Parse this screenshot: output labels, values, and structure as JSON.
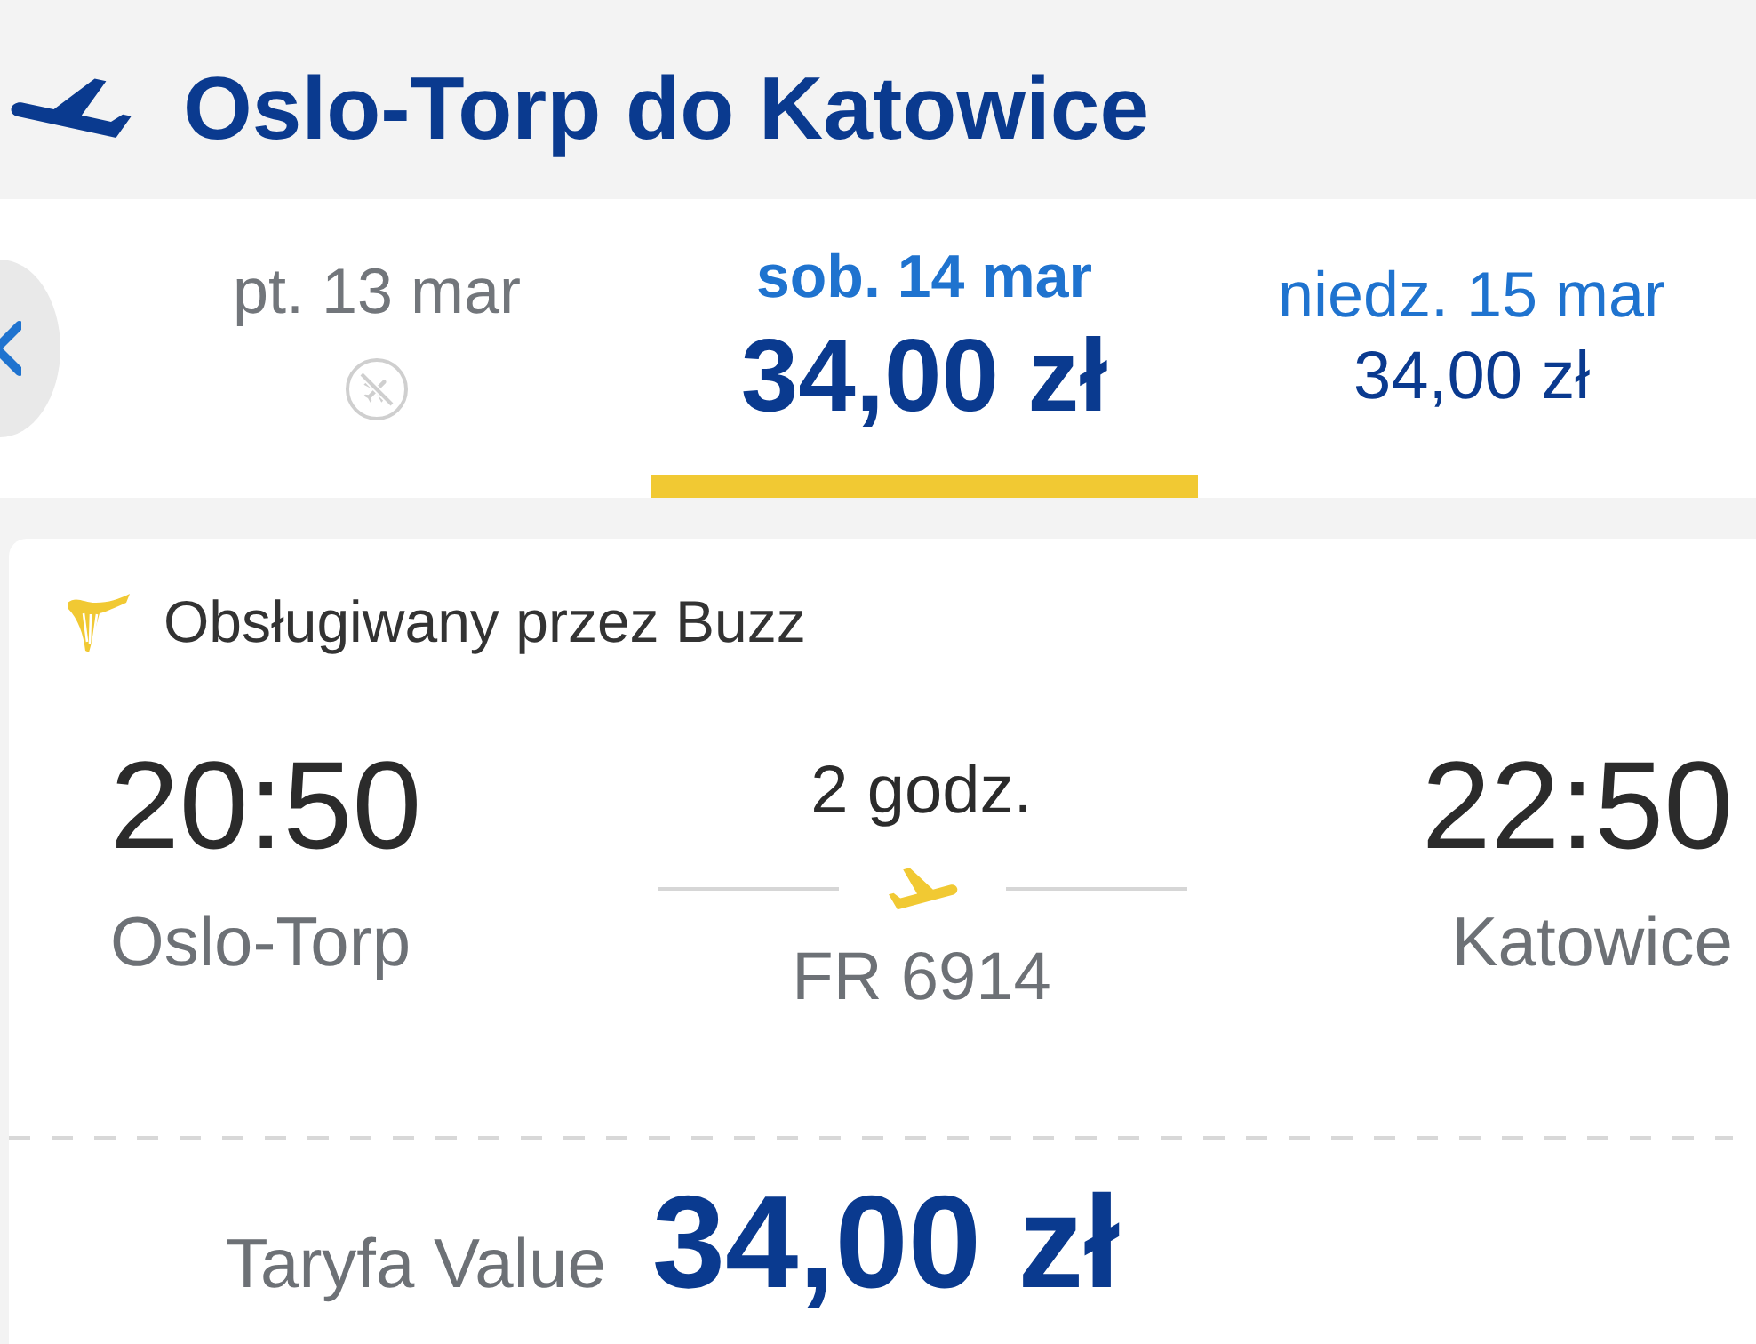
{
  "header": {
    "title": "Oslo-Torp do Katowice"
  },
  "dates": [
    {
      "kind": "no_flights",
      "label": "pt. 13 mar",
      "selected": false
    },
    {
      "kind": "fare",
      "label": "sob. 14 mar",
      "price": "34,00 zł",
      "selected": true
    },
    {
      "kind": "fare",
      "label": "niedz. 15 mar",
      "price": "34,00 zł",
      "selected": false
    }
  ],
  "flight": {
    "operator": "Obsługiwany przez Buzz",
    "departure": {
      "time": "20:50",
      "airport": "Oslo-Torp"
    },
    "duration": "2 godz.",
    "flight_number": "FR 6914",
    "arrival": {
      "time": "22:50",
      "airport": "Katowice"
    }
  },
  "fare": {
    "label": "Taryfa Value",
    "price": "34,00 zł"
  }
}
